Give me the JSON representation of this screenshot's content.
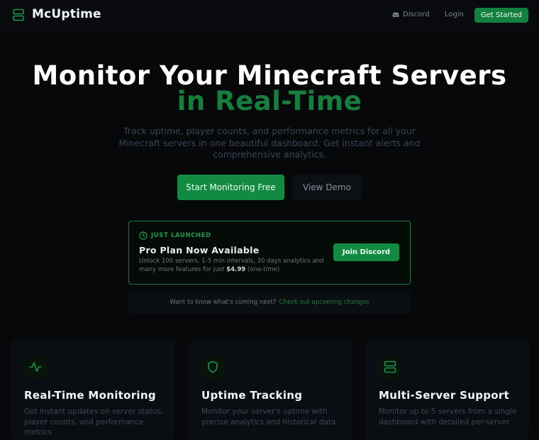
{
  "nav": {
    "brand": "McUptime",
    "discord": "Discord",
    "login": "Login",
    "cta": "Get Started"
  },
  "hero": {
    "title": "Monitor Your Minecraft Servers",
    "accent": "in Real-Time",
    "subtitle": "Track uptime, player counts, and performance metrics for all your Minecraft servers in one beautiful dashboard. Get instant alerts and comprehensive analytics.",
    "primary_btn": "Start Monitoring Free",
    "secondary_btn": "View Demo"
  },
  "promo": {
    "tag": "JUST LAUNCHED",
    "title": "Pro Plan Now Available",
    "desc_prefix": "Unlock 100 servers, 1-5 min intervals, 30 days analytics and many more features for just",
    "price": "$4.99",
    "desc_suffix": "(one-time)",
    "button": "Join Discord"
  },
  "upcoming": {
    "text": "Want to know what's coming next?",
    "link": "Check out upcoming changes"
  },
  "features": [
    {
      "icon": "activity-icon",
      "title": "Real-Time Monitoring",
      "desc": "Get instant updates on server status, player counts, and performance metrics"
    },
    {
      "icon": "shield-icon",
      "title": "Uptime Tracking",
      "desc": "Monitor your server's uptime with precise analytics and historical data"
    },
    {
      "icon": "server-icon",
      "title": "Multi-Server Support",
      "desc": "Monitor up to 5 servers from a single dashboard with detailed per-server"
    }
  ],
  "colors": {
    "accent": "#15803d",
    "button": "#138a42",
    "background": "#06080a"
  }
}
